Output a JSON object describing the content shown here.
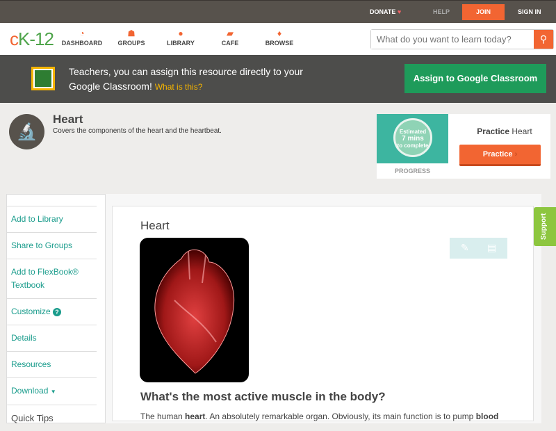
{
  "topbar": {
    "donate": "DONATE",
    "help": "HELP",
    "join": "JOIN",
    "signin": "SIGN IN"
  },
  "nav": {
    "logo": "cK-12",
    "items": [
      {
        "label": "DASHBOARD",
        "icon": "gauge-icon"
      },
      {
        "label": "GROUPS",
        "icon": "people-icon"
      },
      {
        "label": "LIBRARY",
        "icon": "backpack-icon"
      },
      {
        "label": "CAFE",
        "icon": "chat-icon"
      },
      {
        "label": "BROWSE",
        "icon": "lightbulb-icon"
      }
    ],
    "search_placeholder": "What do you want to learn today?"
  },
  "banner": {
    "text": "Teachers, you can assign this resource directly to your Google Classroom!",
    "link": "What is this?",
    "button": "Assign to Google Classroom"
  },
  "concept": {
    "title": "Heart",
    "subtitle": "Covers the components of the heart and the heartbeat."
  },
  "practice": {
    "estimate_line1": "Estimated",
    "estimate_line2": "7 mins",
    "estimate_line3": "to complete",
    "progress": "PROGRESS",
    "title_bold": "Practice",
    "title_rest": "Heart",
    "button": "Practice"
  },
  "sidebar": {
    "items": [
      "Add to Library",
      "Share to Groups",
      "Add to FlexBook® Textbook",
      "Customize",
      "Details",
      "Resources",
      "Download"
    ],
    "quick_tips": "Quick Tips"
  },
  "content": {
    "title": "Heart",
    "question": "What's the most active muscle in the body?",
    "para_start": "The human ",
    "para_b1": "heart",
    "para_mid": ". An absolutely remarkable organ. Obviously, its main function is to pump ",
    "para_b2": "blood"
  },
  "support": "Support",
  "colors": {
    "accent": "#f26532",
    "teal": "#1a9c8c",
    "green": "#1e9b5a"
  }
}
